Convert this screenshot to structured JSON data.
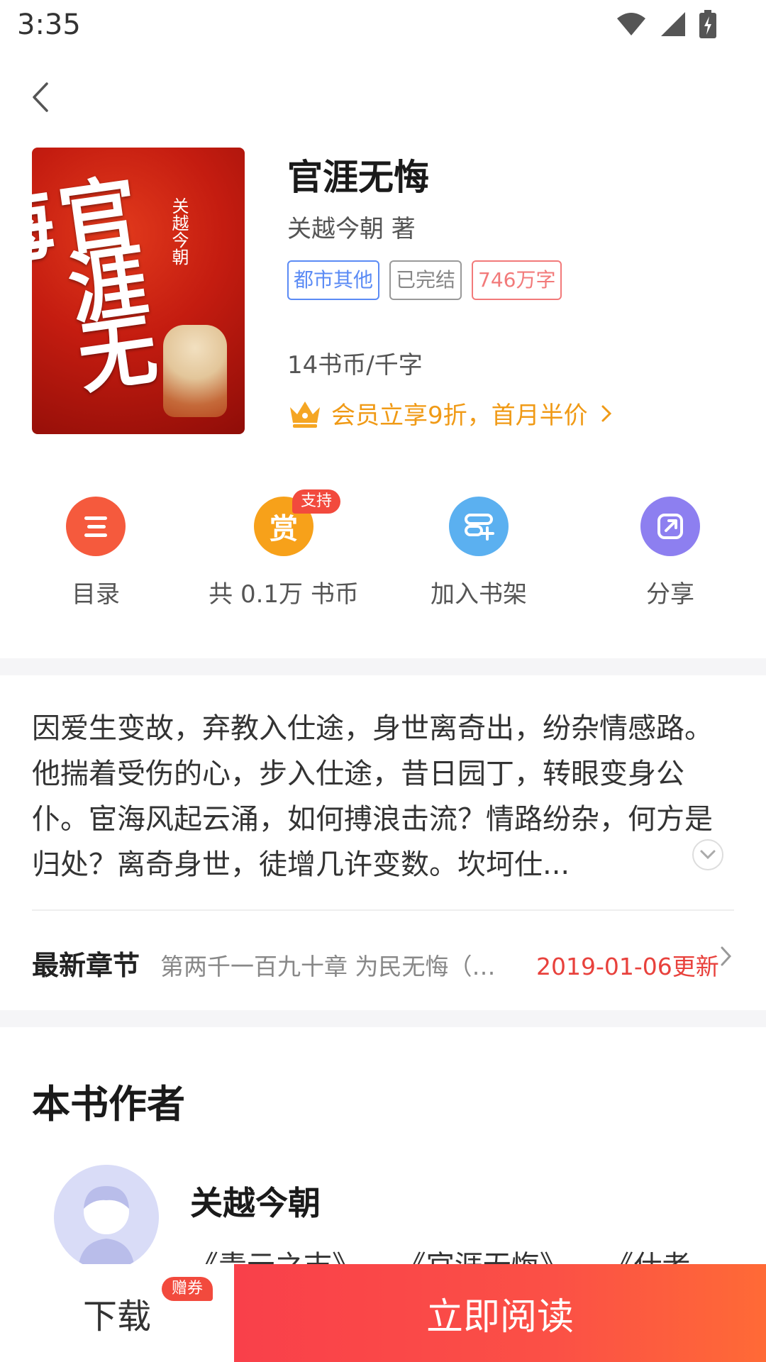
{
  "status_bar": {
    "time": "3:35"
  },
  "book": {
    "title": "官涯无悔",
    "author": "关越今朝 著",
    "tags": [
      "都市其他",
      "已完结",
      "746万字"
    ],
    "price": "14书币/千字",
    "vip_offer": "会员立享9折，首月半价",
    "cover": {
      "title": "官涯无悔",
      "author": "关越今朝"
    }
  },
  "actions": {
    "catalog": "目录",
    "reward": "共 0.1万 书币",
    "reward_badge": "支持",
    "reward_icon": "赏",
    "bookshelf": "加入书架",
    "share": "分享"
  },
  "description": "因爱生变故，弃教入仕途，身世离奇出，纷杂情感路。他揣着受伤的心，步入仕途，昔日园丁，转眼变身公仆。宦海风起云涌，如何搏浪击流？情路纷杂，何方是归处？离奇身世，徒增几许变数。坎坷仕...",
  "latest": {
    "label": "最新章节",
    "chapter": "第两千一百九十章 为民无悔（…",
    "date": "2019-01-06更新"
  },
  "author_section": {
    "heading": "本书作者",
    "name": "关越今朝",
    "works": "《青云之志》 《官涯无悔》 《仕者"
  },
  "bottom": {
    "download": "下载",
    "gift_badge": "赠券",
    "read": "立即阅读"
  },
  "colors": {
    "catalog_icon": "#f55a3d",
    "reward_icon": "#f7a11a",
    "bookshelf_icon": "#5bb0f0",
    "share_icon": "#8d7ff0",
    "accent_red": "#e8413c",
    "vip_orange": "#f09a16"
  }
}
